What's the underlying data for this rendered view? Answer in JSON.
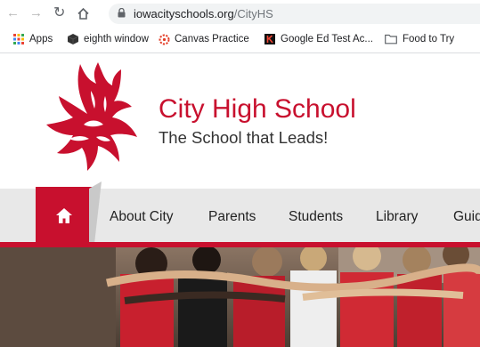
{
  "browser": {
    "url_domain": "iowacityschools.org",
    "url_path": "/CityHS"
  },
  "bookmarks": [
    {
      "label": "Apps",
      "icon": "apps-grid-icon"
    },
    {
      "label": "eighth window",
      "icon": "dark-cube-icon"
    },
    {
      "label": "Canvas Practice",
      "icon": "canvas-logo-icon"
    },
    {
      "label": "Google Ed Test Ac...",
      "icon": "k-logo-icon"
    },
    {
      "label": "Food to Try",
      "icon": "folder-icon"
    }
  ],
  "school": {
    "name": "City High School",
    "tagline": "The School that Leads!"
  },
  "nav": {
    "items": [
      "About City",
      "Parents",
      "Students",
      "Library",
      "Guid"
    ]
  },
  "colors": {
    "brand_red": "#c8102e",
    "nav_bg": "#e8e8e8"
  }
}
